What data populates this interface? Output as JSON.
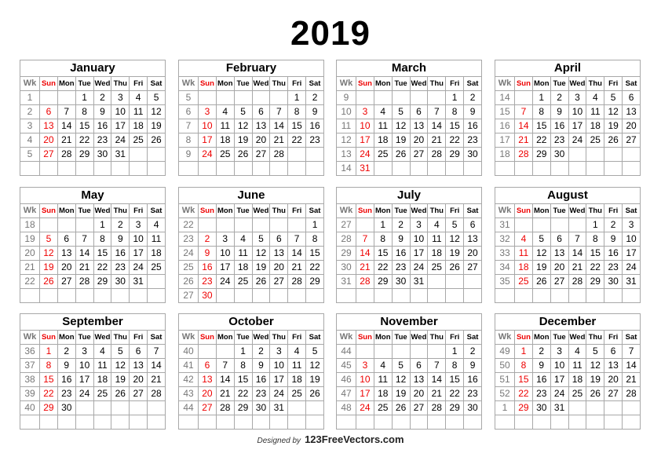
{
  "year": "2019",
  "weekday_headers": [
    "Wk",
    "Sun",
    "Mon",
    "Tue",
    "Wed",
    "Thu",
    "Fri",
    "Sat"
  ],
  "footer": {
    "designed_by": "Designed by",
    "site": "123FreeVectors.com"
  },
  "colors": {
    "sunday": "#ee0000",
    "week_number": "#777777",
    "grid": "#a8a8a8"
  },
  "months": [
    {
      "name": "January",
      "rows": [
        [
          "1",
          "",
          "",
          "1",
          "2",
          "3",
          "4",
          "5"
        ],
        [
          "2",
          "6",
          "7",
          "8",
          "9",
          "10",
          "11",
          "12"
        ],
        [
          "3",
          "13",
          "14",
          "15",
          "16",
          "17",
          "18",
          "19"
        ],
        [
          "4",
          "20",
          "21",
          "22",
          "23",
          "24",
          "25",
          "26"
        ],
        [
          "5",
          "27",
          "28",
          "29",
          "30",
          "31",
          "",
          ""
        ],
        [
          "",
          "",
          "",
          "",
          "",
          "",
          "",
          ""
        ]
      ]
    },
    {
      "name": "February",
      "rows": [
        [
          "5",
          "",
          "",
          "",
          "",
          "",
          "1",
          "2"
        ],
        [
          "6",
          "3",
          "4",
          "5",
          "6",
          "7",
          "8",
          "9"
        ],
        [
          "7",
          "10",
          "11",
          "12",
          "13",
          "14",
          "15",
          "16"
        ],
        [
          "8",
          "17",
          "18",
          "19",
          "20",
          "21",
          "22",
          "23"
        ],
        [
          "9",
          "24",
          "25",
          "26",
          "27",
          "28",
          "",
          ""
        ],
        [
          "",
          "",
          "",
          "",
          "",
          "",
          "",
          ""
        ]
      ]
    },
    {
      "name": "March",
      "rows": [
        [
          "9",
          "",
          "",
          "",
          "",
          "",
          "1",
          "2"
        ],
        [
          "10",
          "3",
          "4",
          "5",
          "6",
          "7",
          "8",
          "9"
        ],
        [
          "11",
          "10",
          "11",
          "12",
          "13",
          "14",
          "15",
          "16"
        ],
        [
          "12",
          "17",
          "18",
          "19",
          "20",
          "21",
          "22",
          "23"
        ],
        [
          "13",
          "24",
          "25",
          "26",
          "27",
          "28",
          "29",
          "30"
        ],
        [
          "14",
          "31",
          "",
          "",
          "",
          "",
          "",
          ""
        ]
      ]
    },
    {
      "name": "April",
      "rows": [
        [
          "14",
          "",
          "1",
          "2",
          "3",
          "4",
          "5",
          "6"
        ],
        [
          "15",
          "7",
          "8",
          "9",
          "10",
          "11",
          "12",
          "13"
        ],
        [
          "16",
          "14",
          "15",
          "16",
          "17",
          "18",
          "19",
          "20"
        ],
        [
          "17",
          "21",
          "22",
          "23",
          "24",
          "25",
          "26",
          "27"
        ],
        [
          "18",
          "28",
          "29",
          "30",
          "",
          "",
          "",
          ""
        ],
        [
          "",
          "",
          "",
          "",
          "",
          "",
          "",
          ""
        ]
      ]
    },
    {
      "name": "May",
      "rows": [
        [
          "18",
          "",
          "",
          "",
          "1",
          "2",
          "3",
          "4"
        ],
        [
          "19",
          "5",
          "6",
          "7",
          "8",
          "9",
          "10",
          "11"
        ],
        [
          "20",
          "12",
          "13",
          "14",
          "15",
          "16",
          "17",
          "18"
        ],
        [
          "21",
          "19",
          "20",
          "21",
          "22",
          "23",
          "24",
          "25"
        ],
        [
          "22",
          "26",
          "27",
          "28",
          "29",
          "30",
          "31",
          ""
        ],
        [
          "",
          "",
          "",
          "",
          "",
          "",
          "",
          ""
        ]
      ]
    },
    {
      "name": "June",
      "rows": [
        [
          "22",
          "",
          "",
          "",
          "",
          "",
          "",
          "1"
        ],
        [
          "23",
          "2",
          "3",
          "4",
          "5",
          "6",
          "7",
          "8"
        ],
        [
          "24",
          "9",
          "10",
          "11",
          "12",
          "13",
          "14",
          "15"
        ],
        [
          "25",
          "16",
          "17",
          "18",
          "19",
          "20",
          "21",
          "22"
        ],
        [
          "26",
          "23",
          "24",
          "25",
          "26",
          "27",
          "28",
          "29"
        ],
        [
          "27",
          "30",
          "",
          "",
          "",
          "",
          "",
          ""
        ]
      ]
    },
    {
      "name": "July",
      "rows": [
        [
          "27",
          "",
          "1",
          "2",
          "3",
          "4",
          "5",
          "6"
        ],
        [
          "28",
          "7",
          "8",
          "9",
          "10",
          "11",
          "12",
          "13"
        ],
        [
          "29",
          "14",
          "15",
          "16",
          "17",
          "18",
          "19",
          "20"
        ],
        [
          "30",
          "21",
          "22",
          "23",
          "24",
          "25",
          "26",
          "27"
        ],
        [
          "31",
          "28",
          "29",
          "30",
          "31",
          "",
          "",
          ""
        ],
        [
          "",
          "",
          "",
          "",
          "",
          "",
          "",
          ""
        ]
      ]
    },
    {
      "name": "August",
      "rows": [
        [
          "31",
          "",
          "",
          "",
          "",
          "1",
          "2",
          "3"
        ],
        [
          "32",
          "4",
          "5",
          "6",
          "7",
          "8",
          "9",
          "10"
        ],
        [
          "33",
          "11",
          "12",
          "13",
          "14",
          "15",
          "16",
          "17"
        ],
        [
          "34",
          "18",
          "19",
          "20",
          "21",
          "22",
          "23",
          "24"
        ],
        [
          "35",
          "25",
          "26",
          "27",
          "28",
          "29",
          "30",
          "31"
        ],
        [
          "",
          "",
          "",
          "",
          "",
          "",
          "",
          ""
        ]
      ]
    },
    {
      "name": "September",
      "rows": [
        [
          "36",
          "1",
          "2",
          "3",
          "4",
          "5",
          "6",
          "7"
        ],
        [
          "37",
          "8",
          "9",
          "10",
          "11",
          "12",
          "13",
          "14"
        ],
        [
          "38",
          "15",
          "16",
          "17",
          "18",
          "19",
          "20",
          "21"
        ],
        [
          "39",
          "22",
          "23",
          "24",
          "25",
          "26",
          "27",
          "28"
        ],
        [
          "40",
          "29",
          "30",
          "",
          "",
          "",
          "",
          ""
        ],
        [
          "",
          "",
          "",
          "",
          "",
          "",
          "",
          ""
        ]
      ]
    },
    {
      "name": "October",
      "rows": [
        [
          "40",
          "",
          "",
          "1",
          "2",
          "3",
          "4",
          "5"
        ],
        [
          "41",
          "6",
          "7",
          "8",
          "9",
          "10",
          "11",
          "12"
        ],
        [
          "42",
          "13",
          "14",
          "15",
          "16",
          "17",
          "18",
          "19"
        ],
        [
          "43",
          "20",
          "21",
          "22",
          "23",
          "24",
          "25",
          "26"
        ],
        [
          "44",
          "27",
          "28",
          "29",
          "30",
          "31",
          "",
          ""
        ],
        [
          "",
          "",
          "",
          "",
          "",
          "",
          "",
          ""
        ]
      ]
    },
    {
      "name": "November",
      "rows": [
        [
          "44",
          "",
          "",
          "",
          "",
          "",
          "1",
          "2"
        ],
        [
          "45",
          "3",
          "4",
          "5",
          "6",
          "7",
          "8",
          "9"
        ],
        [
          "46",
          "10",
          "11",
          "12",
          "13",
          "14",
          "15",
          "16"
        ],
        [
          "47",
          "17",
          "18",
          "19",
          "20",
          "21",
          "22",
          "23"
        ],
        [
          "48",
          "24",
          "25",
          "26",
          "27",
          "28",
          "29",
          "30"
        ],
        [
          "",
          "",
          "",
          "",
          "",
          "",
          "",
          ""
        ]
      ]
    },
    {
      "name": "December",
      "rows": [
        [
          "49",
          "1",
          "2",
          "3",
          "4",
          "5",
          "6",
          "7"
        ],
        [
          "50",
          "8",
          "9",
          "10",
          "11",
          "12",
          "13",
          "14"
        ],
        [
          "51",
          "15",
          "16",
          "17",
          "18",
          "19",
          "20",
          "21"
        ],
        [
          "52",
          "22",
          "23",
          "24",
          "25",
          "26",
          "27",
          "28"
        ],
        [
          "1",
          "29",
          "30",
          "31",
          "",
          "",
          "",
          ""
        ],
        [
          "",
          "",
          "",
          "",
          "",
          "",
          "",
          ""
        ]
      ]
    }
  ]
}
